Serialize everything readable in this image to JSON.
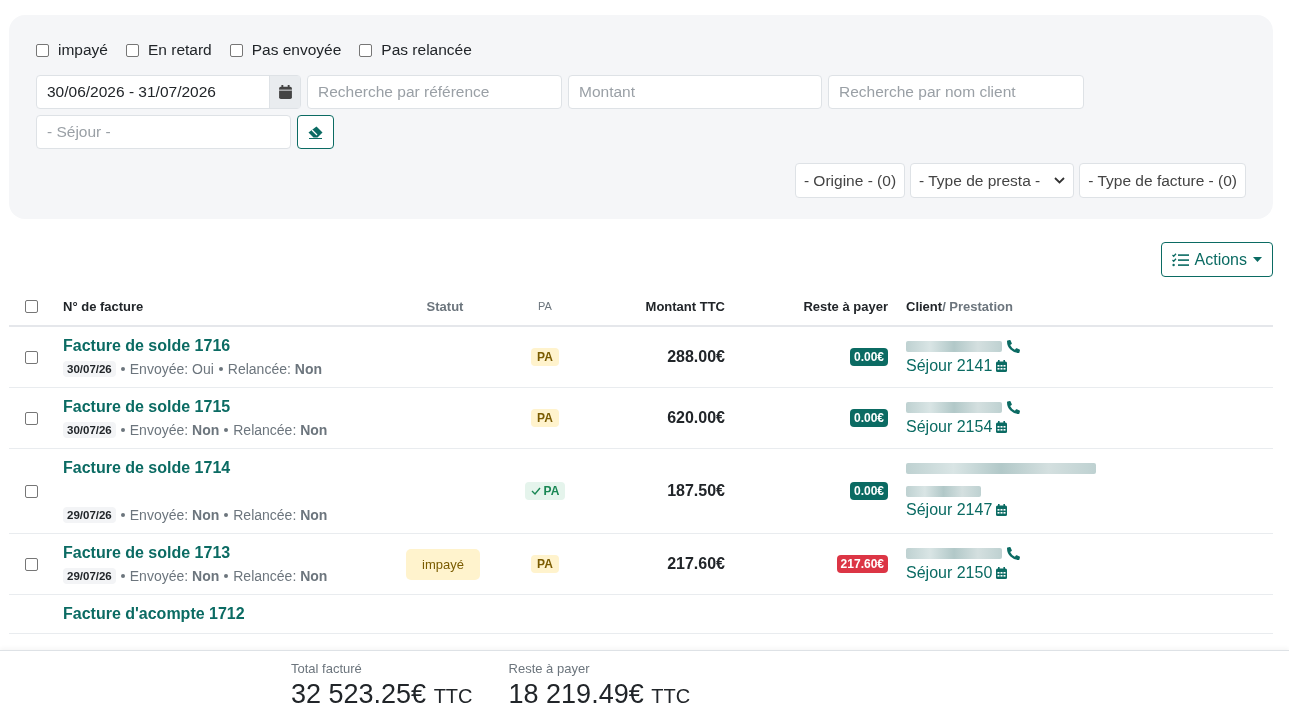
{
  "filters": {
    "checkboxes": [
      {
        "label": "impayé",
        "checked": false
      },
      {
        "label": "En retard",
        "checked": false
      },
      {
        "label": "Pas envoyée",
        "checked": false
      },
      {
        "label": "Pas relancée",
        "checked": false
      }
    ],
    "date_range": {
      "value": "30/06/2026 - 31/07/2026"
    },
    "reference": {
      "placeholder": "Recherche par référence"
    },
    "amount": {
      "placeholder": "Montant"
    },
    "client": {
      "placeholder": "Recherche par nom client"
    },
    "stay": {
      "placeholder": "- Séjour -"
    },
    "dropdowns": [
      {
        "label": "- Origine - (0)",
        "kind": "multi"
      },
      {
        "label": "- Type de presta -",
        "kind": "select"
      },
      {
        "label": "- Type de facture - (0)",
        "kind": "multi"
      }
    ]
  },
  "actions_button": "Actions",
  "table": {
    "select_all": {
      "checked": false
    },
    "columns": [
      "N° de facture",
      "Statut",
      "PA",
      "Montant TTC",
      "Reste à payer",
      "Client",
      "/ Prestation"
    ],
    "rows": [
      {
        "checked": false,
        "title": "Facture de solde 1716",
        "date": "30/07/26",
        "sent": "Envoyée: Oui",
        "reminded": "Relancée: **Non**",
        "pa": {
          "label": "PA",
          "kind": "pending"
        },
        "amount": "288.00€",
        "remaining": {
          "value": "0.00€",
          "due": false
        },
        "wrapped_name": false,
        "phone": true,
        "stay": "Séjour 2141"
      },
      {
        "checked": false,
        "title": "Facture de solde 1715",
        "date": "30/07/26",
        "sent": "Envoyée: **Non**",
        "reminded": "Relancée: **Non**",
        "pa": {
          "label": "PA",
          "kind": "pending"
        },
        "amount": "620.00€",
        "remaining": {
          "value": "0.00€",
          "due": false
        },
        "wrapped_name": false,
        "phone": true,
        "stay": "Séjour 2154"
      },
      {
        "checked": false,
        "title": "Facture de solde 1714",
        "date": "29/07/26",
        "sent": "Envoyée: **Non**",
        "reminded": "Relancée: **Non**",
        "pa": {
          "label": "PA",
          "kind": "validated"
        },
        "amount": "187.50€",
        "remaining": {
          "value": "0.00€",
          "due": false
        },
        "wrapped_name": true,
        "phone": false,
        "stay": "Séjour 2147"
      },
      {
        "checked": false,
        "title": "Facture de solde 1713",
        "date": "29/07/26",
        "sent": "Envoyée: **Non**",
        "reminded": "Relancée: **Non**",
        "status": "impayé",
        "pa": {
          "label": "PA",
          "kind": "pending"
        },
        "amount": "217.60€",
        "remaining": {
          "value": "217.60€",
          "due": true
        },
        "wrapped_name": false,
        "phone": true,
        "stay": "Séjour 2150"
      },
      {
        "title": "Facture d'acompte 1712"
      }
    ]
  },
  "footer": {
    "totals": [
      {
        "label": "Total facturé",
        "value": "32 523.25€",
        "unit": "TTC"
      },
      {
        "label": "Reste à payer",
        "value": "18 219.49€",
        "unit": "TTC"
      }
    ]
  }
}
